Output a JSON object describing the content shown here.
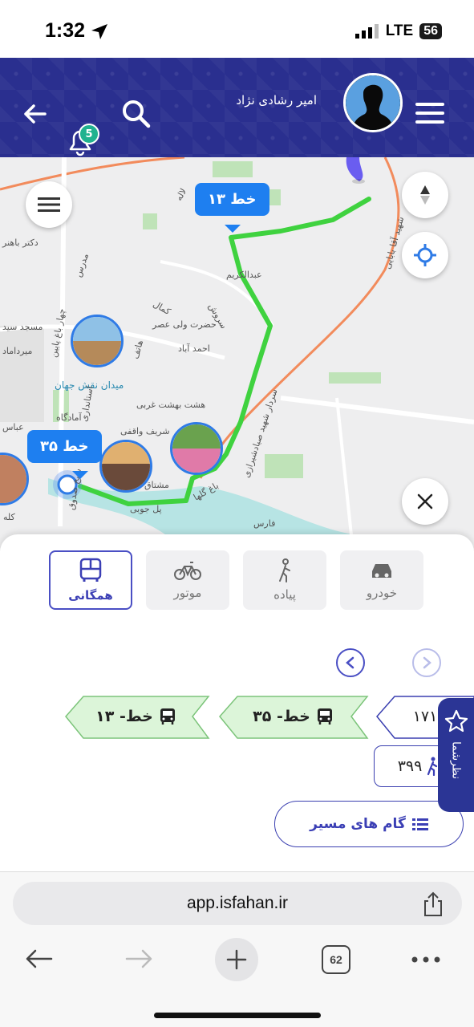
{
  "status_bar": {
    "time": "1:32",
    "network": "LTE",
    "battery": "56"
  },
  "header": {
    "user_name": "امیر رشادی نژاد",
    "notification_count": "5"
  },
  "map": {
    "line_labels": [
      "خط ۱۳",
      "خط ۳۵"
    ],
    "street_labels": [
      "دکتر باهنر",
      "مدرس",
      "چهار باغ پایین",
      "مسجد سید",
      "میرداماد",
      "میدان نقش جهان",
      "استانداری",
      "آمادگاه",
      "عباس",
      "هشت بهشت غربی",
      "شریف واقفی",
      "مشتاق",
      "کمال",
      "حضرت ولی عصر",
      "احمد آباد",
      "هاتف",
      "سروش",
      "عبدالکریم",
      "پل جوبی",
      "باغ گلها",
      "شهید آقا بابایی",
      "سردار شهید صیادشیرازی",
      "فارس",
      "لاله",
      "شیخ صدوق",
      "کله"
    ]
  },
  "transport_modes": [
    {
      "label": "خودرو",
      "icon": "car-icon"
    },
    {
      "label": "پیاده",
      "icon": "walk-icon"
    },
    {
      "label": "موتور",
      "icon": "bicycle-icon"
    },
    {
      "label": "همگانی",
      "icon": "bus-icon",
      "active": true
    }
  ],
  "route_steps": [
    {
      "label": "خط- ۱۳",
      "icon": "bus-icon"
    },
    {
      "label": "خط- ۳۵",
      "icon": "bus-icon"
    },
    {
      "label": "۱۷۱",
      "icon": "walk-icon"
    }
  ],
  "walk_info": {
    "value": "۳۹۹"
  },
  "steps_button": {
    "label": "گام های مسیر"
  },
  "feedback_tab": {
    "label": "نظرشما"
  },
  "browser": {
    "url": "app.isfahan.ir",
    "tab_count": "62"
  },
  "colors": {
    "header_bg": "#2a2f8f",
    "accent": "#3b3fb5",
    "route": "#3fd23f",
    "line_label": "#1e7ff0"
  }
}
